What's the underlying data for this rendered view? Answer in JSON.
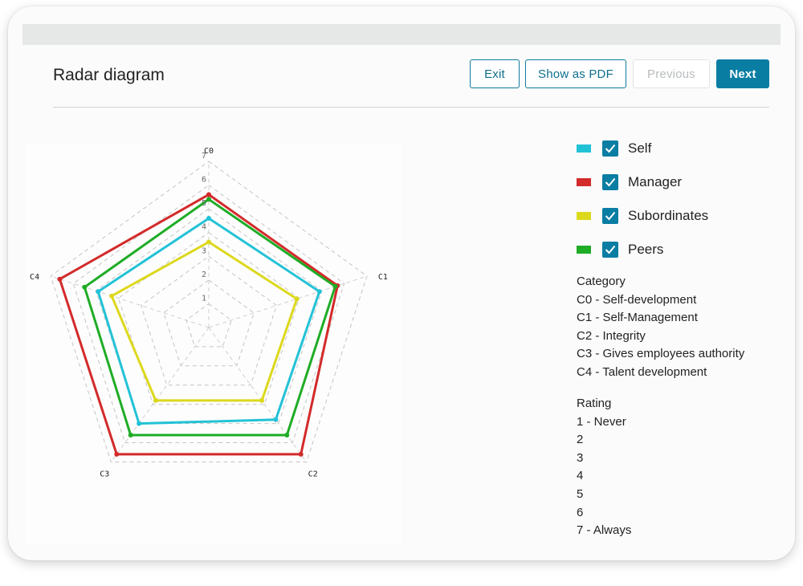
{
  "header": {
    "title": "Radar diagram",
    "buttons": {
      "exit": "Exit",
      "pdf": "Show as PDF",
      "previous": "Previous",
      "next": "Next"
    }
  },
  "legend": [
    {
      "label": "Self",
      "color": "#22c2d6",
      "checked": true
    },
    {
      "label": "Manager",
      "color": "#d32a2a",
      "checked": true
    },
    {
      "label": "Subordinates",
      "color": "#dcd81c",
      "checked": true
    },
    {
      "label": "Peers",
      "color": "#1fac26",
      "checked": true
    }
  ],
  "category": {
    "title": "Category",
    "items": [
      "C0 - Self-development",
      "C1 - Self-Management",
      "C2 - Integrity",
      "C3 - Gives employees authority",
      "C4 - Talent development"
    ]
  },
  "rating": {
    "title": "Rating",
    "items": [
      "1 - Never",
      "2",
      "3",
      "4",
      "5",
      "6",
      "7 - Always"
    ]
  },
  "chart_data": {
    "type": "radar",
    "axes": [
      "C0",
      "C1",
      "C2",
      "C3",
      "C4"
    ],
    "ticks": [
      "1",
      "2",
      "3",
      "4",
      "5",
      "6",
      "7"
    ],
    "rmax": 7,
    "series": [
      {
        "name": "Self",
        "color": "#22c2d6",
        "values": [
          4.6,
          4.9,
          4.8,
          5.0,
          4.9
        ]
      },
      {
        "name": "Manager",
        "color": "#d32a2a",
        "values": [
          5.6,
          5.7,
          6.6,
          6.6,
          6.6
        ]
      },
      {
        "name": "Subordinates",
        "color": "#dcd81c",
        "values": [
          3.6,
          3.9,
          3.8,
          3.8,
          4.3
        ]
      },
      {
        "name": "Peers",
        "color": "#1fac26",
        "values": [
          5.4,
          5.6,
          5.6,
          5.6,
          5.5
        ]
      }
    ]
  }
}
